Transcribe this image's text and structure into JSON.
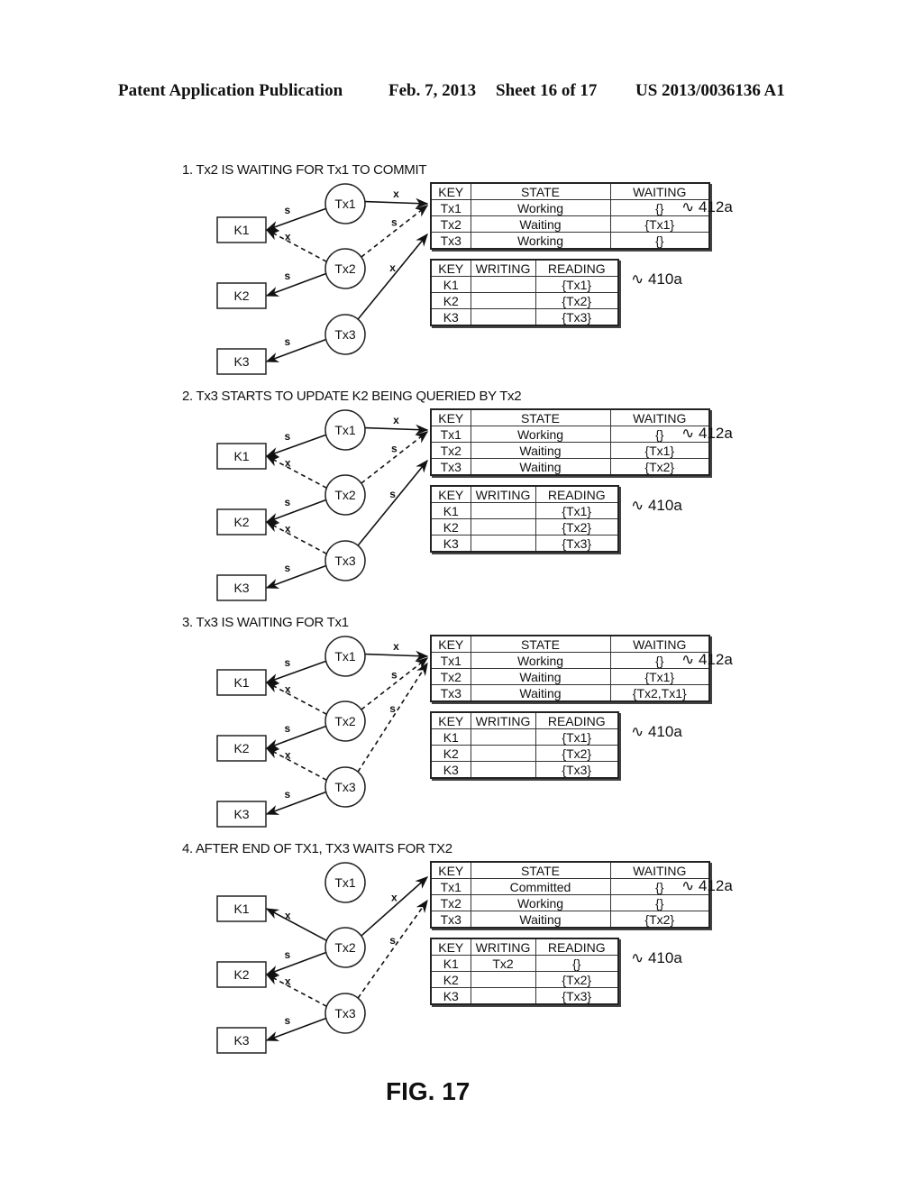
{
  "header": {
    "publication": "Patent Application Publication",
    "date": "Feb. 7, 2013",
    "sheet": "Sheet 16 of 17",
    "number": "US 2013/0036136 A1"
  },
  "figure_label": "FIG. 17",
  "table_refs": {
    "transaction_table": "412a",
    "key_table": "410a"
  },
  "nodes": {
    "keys": [
      "K1",
      "K2",
      "K3"
    ],
    "transactions": [
      "Tx1",
      "Tx2",
      "Tx3"
    ]
  },
  "edge_labels": {
    "shared": "s",
    "exclusive": "x"
  },
  "tx_table_headers": [
    "KEY",
    "STATE",
    "WAITING"
  ],
  "key_table_headers": [
    "KEY",
    "WRITING",
    "READING"
  ],
  "panels": [
    {
      "title": "1. Tx2 IS WAITING FOR Tx1 TO COMMIT",
      "tx_rows": [
        [
          "Tx1",
          "Working",
          "{}"
        ],
        [
          "Tx2",
          "Waiting",
          "{Tx1}"
        ],
        [
          "Tx3",
          "Working",
          "{}"
        ]
      ],
      "key_rows": [
        [
          "K1",
          "",
          "{Tx1}"
        ],
        [
          "K2",
          "",
          "{Tx2}"
        ],
        [
          "K3",
          "",
          "{Tx3}"
        ]
      ],
      "edges": [
        {
          "from": "Tx1",
          "to": "K1",
          "label": "s",
          "style": "solid"
        },
        {
          "from": "Tx2",
          "to": "K1",
          "label": "x",
          "style": "dashed"
        },
        {
          "from": "Tx2",
          "to": "K2",
          "label": "s",
          "style": "solid"
        },
        {
          "from": "Tx3",
          "to": "K3",
          "label": "s",
          "style": "solid"
        },
        {
          "from": "Tx1",
          "to": "table",
          "label": "x",
          "style": "solid"
        },
        {
          "from": "Tx2",
          "to": "table",
          "label": "s",
          "style": "dashed"
        },
        {
          "from": "Tx3",
          "to": "table",
          "label": "x",
          "style": "solid"
        }
      ]
    },
    {
      "title": "2. Tx3 STARTS TO UPDATE K2 BEING QUERIED BY Tx2",
      "tx_rows": [
        [
          "Tx1",
          "Working",
          "{}"
        ],
        [
          "Tx2",
          "Waiting",
          "{Tx1}"
        ],
        [
          "Tx3",
          "Waiting",
          "{Tx2}"
        ]
      ],
      "key_rows": [
        [
          "K1",
          "",
          "{Tx1}"
        ],
        [
          "K2",
          "",
          "{Tx2}"
        ],
        [
          "K3",
          "",
          "{Tx3}"
        ]
      ],
      "edges": [
        {
          "from": "Tx1",
          "to": "K1",
          "label": "s",
          "style": "solid"
        },
        {
          "from": "Tx2",
          "to": "K1",
          "label": "x",
          "style": "dashed"
        },
        {
          "from": "Tx2",
          "to": "K2",
          "label": "s",
          "style": "solid"
        },
        {
          "from": "Tx3",
          "to": "K2",
          "label": "x",
          "style": "dashed"
        },
        {
          "from": "Tx3",
          "to": "K3",
          "label": "s",
          "style": "solid"
        },
        {
          "from": "Tx1",
          "to": "table",
          "label": "x",
          "style": "solid"
        },
        {
          "from": "Tx2",
          "to": "table",
          "label": "s",
          "style": "dashed"
        },
        {
          "from": "Tx3",
          "to": "table",
          "label": "s",
          "style": "solid"
        }
      ]
    },
    {
      "title": "3. Tx3 IS WAITING FOR Tx1",
      "tx_rows": [
        [
          "Tx1",
          "Working",
          "{}"
        ],
        [
          "Tx2",
          "Waiting",
          "{Tx1}"
        ],
        [
          "Tx3",
          "Waiting",
          "{Tx2,Tx1}"
        ]
      ],
      "key_rows": [
        [
          "K1",
          "",
          "{Tx1}"
        ],
        [
          "K2",
          "",
          "{Tx2}"
        ],
        [
          "K3",
          "",
          "{Tx3}"
        ]
      ],
      "edges": [
        {
          "from": "Tx1",
          "to": "K1",
          "label": "s",
          "style": "solid"
        },
        {
          "from": "Tx2",
          "to": "K1",
          "label": "x",
          "style": "dashed"
        },
        {
          "from": "Tx2",
          "to": "K2",
          "label": "s",
          "style": "solid"
        },
        {
          "from": "Tx3",
          "to": "K2",
          "label": "x",
          "style": "dashed"
        },
        {
          "from": "Tx3",
          "to": "K3",
          "label": "s",
          "style": "solid"
        },
        {
          "from": "Tx1",
          "to": "table",
          "label": "x",
          "style": "solid"
        },
        {
          "from": "Tx2",
          "to": "table",
          "label": "s",
          "style": "dashed"
        },
        {
          "from": "Tx3",
          "to": "table",
          "label": "s",
          "style": "dashed"
        }
      ]
    },
    {
      "title": "4. AFTER END OF TX1, TX3 WAITS FOR TX2",
      "tx_rows": [
        [
          "Tx1",
          "Committed",
          "{}"
        ],
        [
          "Tx2",
          "Working",
          "{}"
        ],
        [
          "Tx3",
          "Waiting",
          "{Tx2}"
        ]
      ],
      "key_rows": [
        [
          "K1",
          "Tx2",
          "{}"
        ],
        [
          "K2",
          "",
          "{Tx2}"
        ],
        [
          "K3",
          "",
          "{Tx3}"
        ]
      ],
      "edges": [
        {
          "from": "Tx2",
          "to": "K1",
          "label": "x",
          "style": "solid"
        },
        {
          "from": "Tx2",
          "to": "K2",
          "label": "s",
          "style": "solid"
        },
        {
          "from": "Tx3",
          "to": "K2",
          "label": "x",
          "style": "dashed"
        },
        {
          "from": "Tx3",
          "to": "K3",
          "label": "s",
          "style": "solid"
        },
        {
          "from": "Tx2",
          "to": "table",
          "label": "x",
          "style": "solid"
        },
        {
          "from": "Tx3",
          "to": "table",
          "label": "s",
          "style": "dashed"
        }
      ]
    }
  ]
}
